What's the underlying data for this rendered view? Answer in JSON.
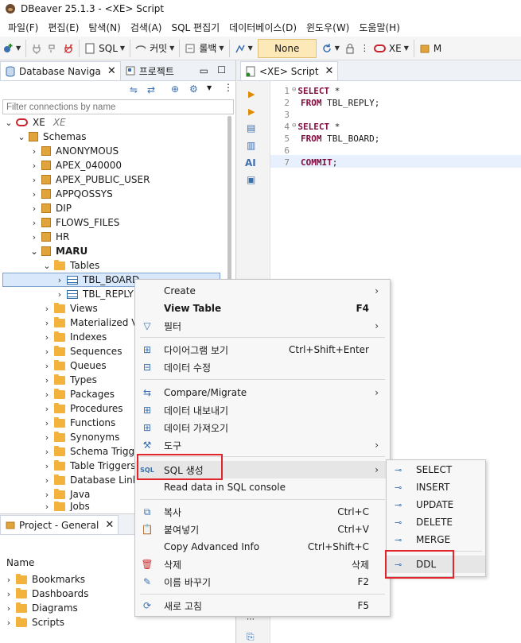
{
  "window": {
    "title": "DBeaver 25.1.3 - <XE> Script"
  },
  "menu": [
    "파일(F)",
    "편집(E)",
    "탐색(N)",
    "검색(A)",
    "SQL 편집기",
    "데이터베이스(D)",
    "윈도우(W)",
    "도움말(H)"
  ],
  "toolbar": {
    "sql_label": "SQL",
    "commit_label": "커밋",
    "rollback_label": "롤백",
    "none_label": "None",
    "conn_label": "XE",
    "more_label": "M"
  },
  "nav": {
    "tab_label": "Database Naviga",
    "tab2_label": "프로젝트",
    "filter_placeholder": "Filter connections by name",
    "connection": {
      "name": "XE",
      "detail": "XE"
    },
    "schemas_label": "Schemas",
    "schemas": [
      "ANONYMOUS",
      "APEX_040000",
      "APEX_PUBLIC_USER",
      "APPQOSSYS",
      "DIP",
      "FLOWS_FILES",
      "HR",
      "MARU"
    ],
    "tables_label": "Tables",
    "tables": [
      "TBL_BOARD",
      "TBL_REPLY"
    ],
    "folders": [
      "Views",
      "Materialized Vi",
      "Indexes",
      "Sequences",
      "Queues",
      "Types",
      "Packages",
      "Procedures",
      "Functions",
      "Synonyms",
      "Schema Trigge",
      "Table Triggers",
      "Database Links",
      "Java",
      "Jobs"
    ]
  },
  "project": {
    "tab_label": "Project - General",
    "column_header": "Name",
    "items": [
      "Bookmarks",
      "Dashboards",
      "Diagrams",
      "Scripts"
    ]
  },
  "editor": {
    "tab_label": "<XE> Script",
    "lines": [
      {
        "num": "1",
        "kw": "SELECT",
        "rest": " *"
      },
      {
        "num": "2",
        "kw": "FROM",
        "rest": " TBL_REPLY;"
      },
      {
        "num": "3",
        "kw": "",
        "rest": ""
      },
      {
        "num": "4",
        "kw": "SELECT",
        "rest": " *"
      },
      {
        "num": "5",
        "kw": "FROM",
        "rest": " TBL_BOARD;"
      },
      {
        "num": "6",
        "kw": "",
        "rest": ""
      },
      {
        "num": "7",
        "kw": "COMMIT",
        "rest": ";"
      }
    ],
    "ai_label": "AI"
  },
  "context_menu": {
    "items": [
      {
        "label": "Create",
        "accel": "",
        "submenu": true
      },
      {
        "label": "View Table",
        "accel": "F4",
        "submenu": false
      },
      {
        "label": "필터",
        "accel": "",
        "submenu": true
      },
      {
        "label": "다이어그램 보기",
        "accel": "Ctrl+Shift+Enter",
        "submenu": false
      },
      {
        "label": "데이터 수정",
        "accel": "",
        "submenu": false
      },
      {
        "label": "Compare/Migrate",
        "accel": "",
        "submenu": true
      },
      {
        "label": "데이터 내보내기",
        "accel": "",
        "submenu": false
      },
      {
        "label": "데이터 가져오기",
        "accel": "",
        "submenu": false
      },
      {
        "label": "도구",
        "accel": "",
        "submenu": true
      },
      {
        "label": "SQL 생성",
        "accel": "",
        "submenu": true
      },
      {
        "label": "Read data in SQL console",
        "accel": "",
        "submenu": false
      },
      {
        "label": "복사",
        "accel": "Ctrl+C",
        "submenu": false
      },
      {
        "label": "붙여넣기",
        "accel": "Ctrl+V",
        "submenu": false
      },
      {
        "label": "Copy Advanced Info",
        "accel": "Ctrl+Shift+C",
        "submenu": false
      },
      {
        "label": "삭제",
        "accel": "삭제",
        "submenu": false
      },
      {
        "label": "이름 바꾸기",
        "accel": "F2",
        "submenu": false
      },
      {
        "label": "새로 고침",
        "accel": "F5",
        "submenu": false
      }
    ]
  },
  "sql_submenu": {
    "items": [
      "SELECT",
      "INSERT",
      "UPDATE",
      "DELETE",
      "MERGE",
      "DDL"
    ]
  },
  "colors": {
    "accent": "#2f6fb0",
    "highlight_red": "#e0262c",
    "keyword": "#7f0b3e",
    "none_bg": "#fde8b8"
  }
}
